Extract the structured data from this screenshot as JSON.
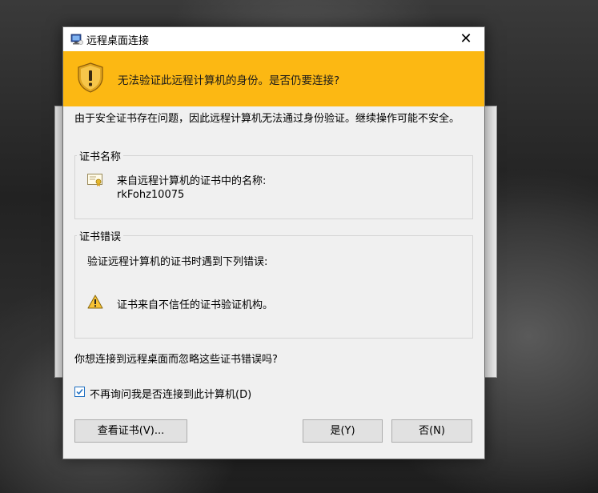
{
  "dialog": {
    "title": "远程桌面连接",
    "banner_text": "无法验证此远程计算机的身份。是否仍要连接?",
    "intro_text": "由于安全证书存在问题，因此远程计算机无法通过身份验证。继续操作可能不安全。"
  },
  "cert_name_group": {
    "legend": "证书名称",
    "line1": "来自远程计算机的证书中的名称:",
    "cert_name": "rkFohz10075"
  },
  "cert_error_group": {
    "legend": "证书错误",
    "line1": "验证远程计算机的证书时遇到下列错误:",
    "error_item": "证书来自不信任的证书验证机构。"
  },
  "question_text": "你想连接到远程桌面而忽略这些证书错误吗?",
  "checkbox": {
    "label": "不再询问我是否连接到此计算机(D)",
    "checked": true
  },
  "buttons": {
    "view_cert": "查看证书(V)...",
    "yes": "是(Y)",
    "no": "否(N)"
  },
  "colors": {
    "banner": "#fcb813",
    "dialog_bg": "#f0f0f0",
    "checkbox_accent": "#1e6fc1"
  },
  "icons": {
    "app": "remote-desktop-icon",
    "shield": "warning-shield-icon",
    "cert": "certificate-icon",
    "warning": "warning-triangle-icon",
    "close": "close-icon"
  }
}
